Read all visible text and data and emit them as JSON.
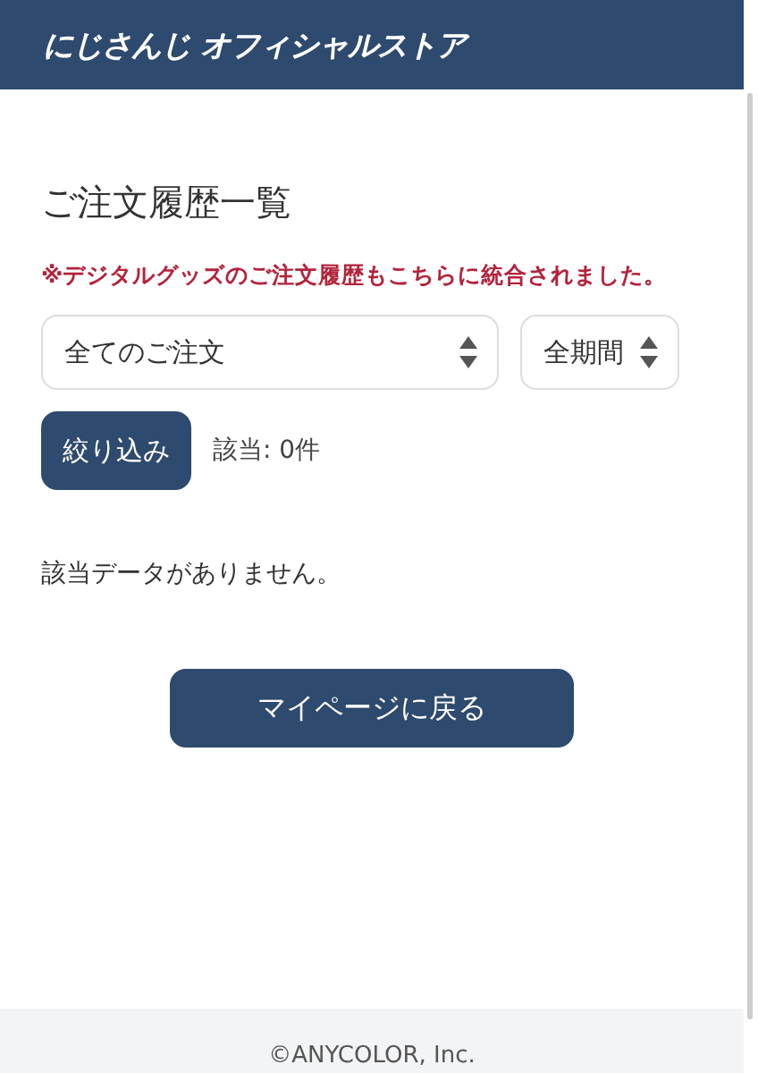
{
  "header": {
    "logo": "にじさんじ オフィシャルストア"
  },
  "page": {
    "title": "ご注文履歴一覧",
    "notice": "※デジタルグッズのご注文履歴もこちらに統合されました。"
  },
  "filters": {
    "selects": [
      {
        "value": "全てのご注文"
      },
      {
        "value": "全期間"
      }
    ],
    "submit": "絞り込み",
    "count": "該当: 0件"
  },
  "empty_message": "該当データがありません。",
  "back_button": "マイページに戻る",
  "footer": {
    "copyright": "©ANYCOLOR, Inc."
  }
}
